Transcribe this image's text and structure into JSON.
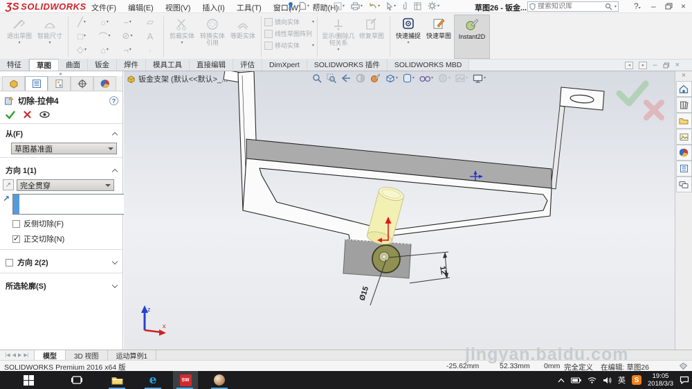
{
  "titlebar": {
    "logo_mark": "ƷS",
    "logo_text": "SOLIDWORKS",
    "menus": [
      "文件(F)",
      "编辑(E)",
      "视图(V)",
      "插入(I)",
      "工具(T)",
      "窗口(W)",
      "帮助(H)"
    ],
    "doc_title": "草图26 - 钣金...",
    "search_placeholder": "搜索知识库"
  },
  "command_manager": {
    "buttons": {
      "exit_sketch": "退出草图",
      "smart_dimension": "智能尺寸",
      "trim_entities": "剪裁实体",
      "convert_entities": "转换实体引用",
      "offset_entities": "等距实体",
      "mirror_entities": "镜向实体",
      "linear_pattern": "线性草图阵列",
      "move_entities": "移动实体",
      "display_delete_relations": "显示/删除几何关系",
      "repair_sketch": "修复草图",
      "quick_snaps": "快速捕捉",
      "rapid_sketch": "快速草图",
      "instant2d": "Instant2D"
    }
  },
  "ribbon_tabs": {
    "items": [
      "特征",
      "草图",
      "曲面",
      "钣金",
      "焊件",
      "模具工具",
      "直接编辑",
      "评估",
      "DimXpert",
      "SOLIDWORKS 插件",
      "SOLIDWORKS MBD"
    ],
    "active": "草图"
  },
  "property_manager": {
    "title": "切除-拉伸4",
    "sections": {
      "from": {
        "label": "从(F)",
        "value": "草图基准面"
      },
      "direction1": {
        "label": "方向 1(1)",
        "value": "完全贯穿",
        "flip_side": "反侧切除(F)",
        "flip_side_checked": false,
        "normal_cut": "正交切除(N)",
        "normal_cut_checked": true
      },
      "direction2": {
        "label": "方向 2(2)",
        "checked": false
      },
      "selected_contours": {
        "label": "所选轮廓(S)"
      }
    }
  },
  "viewport": {
    "doc_label": "钣金支架 (默认<<默认>_...",
    "dimensions": {
      "diameter": "Ø15",
      "offset": "12"
    },
    "triad": {
      "z": "z",
      "x": "x"
    },
    "watermark": "jingyan.baidu.com"
  },
  "bottom_tabs": {
    "items": [
      "模型",
      "3D 视图",
      "运动算例1"
    ],
    "active": "模型"
  },
  "status_bar": {
    "product": "SOLIDWORKS Premium 2016 x64 版",
    "coord_x": "-25.62mm",
    "coord_y": "52.33mm",
    "coord_z": "0mm",
    "state": "完全定义",
    "editing": "在编辑: 草图26"
  },
  "taskbar": {
    "ime": "英",
    "time": "19:05",
    "date": "2018/3/3"
  },
  "colors": {
    "logo_red": "#d2232a",
    "selection_blue": "#569ade",
    "taskbar_underline": "#5aa5e0",
    "instant2d_highlight": "#d9d9d9",
    "cylinder_preview": "#f2f0b2",
    "sketch_region_olive": "#8f9052"
  }
}
